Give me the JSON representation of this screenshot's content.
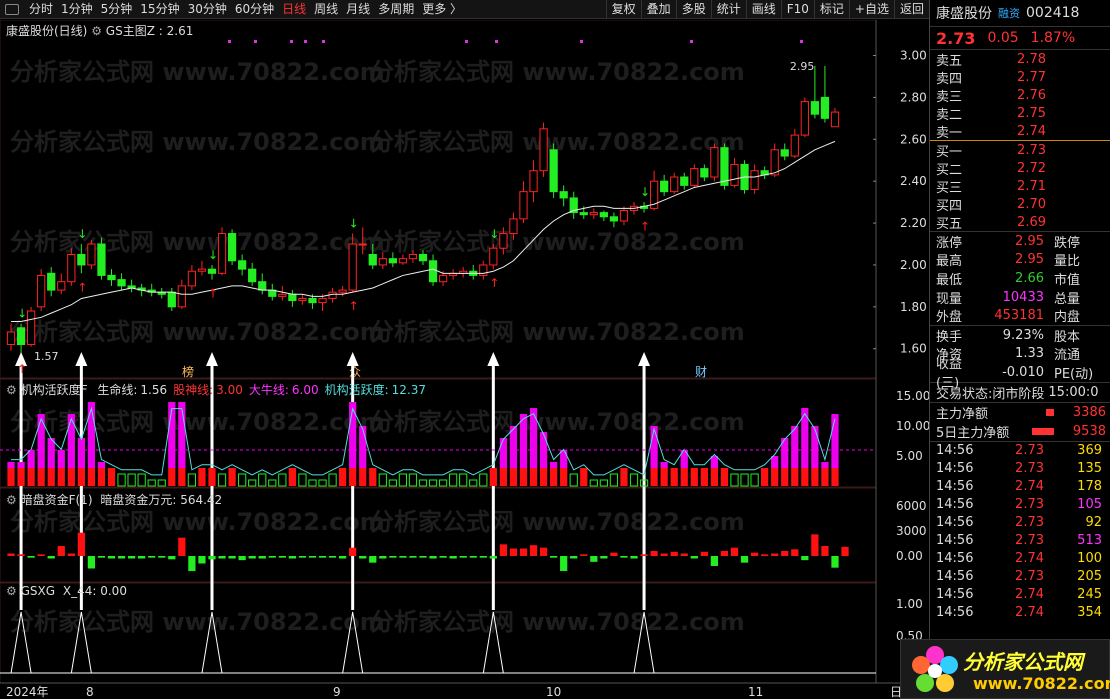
{
  "nav": {
    "periods": [
      "分时",
      "1分钟",
      "5分钟",
      "15分钟",
      "30分钟",
      "60分钟",
      "日线",
      "周线",
      "月线",
      "多周期",
      "更多 〉"
    ],
    "active": "日线",
    "tools": [
      "复权",
      "叠加",
      "多股",
      "统计",
      "画线",
      "F10",
      "标记",
      "+自选",
      "返回"
    ]
  },
  "main": {
    "stock": "康盛股份(日线)",
    "indicator": "GS主图Z",
    "indicator_value": ": 2.61",
    "max_label": "2.95",
    "min_label": "1.57",
    "axis": [
      "3.00",
      "2.80",
      "2.60",
      "2.40",
      "2.20",
      "2.00",
      "1.80",
      "1.60"
    ],
    "tags": [
      "榜",
      "众",
      "财"
    ]
  },
  "sub1": {
    "name": "机构活跃度F",
    "items": [
      {
        "label": "生命线:",
        "value": "1.56",
        "color": "#dddddd"
      },
      {
        "label": "股神线:",
        "value": "3.00",
        "color": "#ff3333"
      },
      {
        "label": "大牛线:",
        "value": "6.00",
        "color": "#ff33ff"
      },
      {
        "label": "机构活跃度:",
        "value": "12.37",
        "color": "#55dddd"
      }
    ],
    "axis": [
      "15.00",
      "10.00",
      "5.00"
    ]
  },
  "sub2": {
    "name": "暗盘资金F(1)",
    "label": "暗盘资金万元:",
    "value": "564.42",
    "axis": [
      "6000",
      "3000",
      "0.00"
    ]
  },
  "sub3": {
    "name": "GSXG",
    "label": "X_44:",
    "value": "0.00",
    "axis": [
      "1.00",
      "0.50"
    ]
  },
  "xaxis": [
    "2024年",
    "8",
    "9",
    "10",
    "11",
    "日"
  ],
  "watermark": "分析家公式网 www.70822.com",
  "quote": {
    "name": "康盛股份",
    "tag": "融资",
    "code": "002418",
    "price": "2.73",
    "change": "0.05",
    "pct": "1.87%",
    "asks": [
      [
        "卖五",
        "2.78"
      ],
      [
        "卖四",
        "2.77"
      ],
      [
        "卖三",
        "2.76"
      ],
      [
        "卖二",
        "2.75"
      ],
      [
        "卖一",
        "2.74"
      ]
    ],
    "bids": [
      [
        "买一",
        "2.73"
      ],
      [
        "买二",
        "2.72"
      ],
      [
        "买三",
        "2.71"
      ],
      [
        "买四",
        "2.70"
      ],
      [
        "买五",
        "2.69"
      ]
    ],
    "stats": [
      [
        "涨停",
        "2.95",
        "#ff3333",
        "跌停"
      ],
      [
        "最高",
        "2.95",
        "#ff3333",
        "量比"
      ],
      [
        "最低",
        "2.66",
        "#33cc33",
        "市值"
      ],
      [
        "现量",
        "10433",
        "#ff33ff",
        "总量"
      ],
      [
        "外盘",
        "453181",
        "#ff3333",
        "内盘"
      ]
    ],
    "stats2": [
      [
        "换手",
        "9.23%",
        "#dddddd",
        "股本"
      ],
      [
        "净资",
        "1.33",
        "#dddddd",
        "流通"
      ],
      [
        "收益(三)",
        "-0.010",
        "#dddddd",
        "PE(动)"
      ]
    ],
    "status_label": "交易状态:",
    "status_value": "闭市阶段",
    "status_time": "15:00:0",
    "flow": [
      [
        "主力净额",
        "3386"
      ],
      [
        "5日主力净额",
        "9538"
      ]
    ],
    "ticks": [
      [
        "14:56",
        "2.73",
        "369",
        "#ff3333",
        "#ffdd00"
      ],
      [
        "14:56",
        "2.73",
        "135",
        "#ff3333",
        "#ffdd00"
      ],
      [
        "14:56",
        "2.74",
        "178",
        "#ff3333",
        "#ffdd00"
      ],
      [
        "14:56",
        "2.73",
        "105",
        "#ff3333",
        "#ff33ff"
      ],
      [
        "14:56",
        "2.73",
        "92",
        "#ff3333",
        "#ffdd00"
      ],
      [
        "14:56",
        "2.73",
        "513",
        "#ff3333",
        "#ff33ff"
      ],
      [
        "14:56",
        "2.74",
        "100",
        "#ff3333",
        "#ffdd00"
      ],
      [
        "14:56",
        "2.73",
        "205",
        "#ff3333",
        "#ffdd00"
      ],
      [
        "14:56",
        "2.74",
        "245",
        "#ff3333",
        "#ffdd00"
      ],
      [
        "14:56",
        "2.74",
        "354",
        "#ff3333",
        "#ffdd00"
      ]
    ]
  },
  "logo": {
    "title": "分析家公式网",
    "url": "www.70822.com"
  },
  "chart_data": {
    "type": "candlestick",
    "series": [
      {
        "name": "K线",
        "values": [
          [
            1.62,
            1.68,
            1.72,
            1.59
          ],
          [
            1.7,
            1.62,
            1.72,
            1.57
          ],
          [
            1.62,
            1.78,
            1.8,
            1.61
          ],
          [
            1.8,
            1.95,
            1.98,
            1.78
          ],
          [
            1.96,
            1.88,
            1.99,
            1.85
          ],
          [
            1.88,
            1.92,
            1.96,
            1.86
          ],
          [
            1.92,
            2.05,
            2.08,
            1.9
          ],
          [
            2.05,
            2.0,
            2.1,
            1.96
          ],
          [
            2.0,
            2.1,
            2.12,
            1.98
          ],
          [
            2.1,
            1.95,
            2.13,
            1.93
          ],
          [
            1.95,
            1.93,
            1.98,
            1.9
          ],
          [
            1.93,
            1.9,
            1.96,
            1.88
          ],
          [
            1.9,
            1.89,
            1.93,
            1.87
          ],
          [
            1.89,
            1.88,
            1.91,
            1.85
          ],
          [
            1.88,
            1.87,
            1.91,
            1.85
          ],
          [
            1.87,
            1.86,
            1.89,
            1.84
          ],
          [
            1.87,
            1.8,
            1.89,
            1.78
          ],
          [
            1.8,
            1.9,
            1.93,
            1.79
          ],
          [
            1.9,
            1.97,
            2.0,
            1.88
          ],
          [
            1.97,
            1.98,
            2.02,
            1.95
          ],
          [
            1.98,
            1.96,
            2.0,
            1.93
          ],
          [
            1.96,
            2.15,
            2.18,
            1.95
          ],
          [
            2.15,
            2.02,
            2.17,
            2.0
          ],
          [
            2.02,
            1.98,
            2.05,
            1.95
          ],
          [
            1.98,
            1.92,
            2.01,
            1.9
          ],
          [
            1.92,
            1.88,
            1.96,
            1.86
          ],
          [
            1.88,
            1.85,
            1.91,
            1.83
          ],
          [
            1.85,
            1.86,
            1.9,
            1.83
          ],
          [
            1.86,
            1.83,
            1.88,
            1.8
          ],
          [
            1.83,
            1.84,
            1.86,
            1.81
          ],
          [
            1.84,
            1.82,
            1.86,
            1.79
          ],
          [
            1.82,
            1.84,
            1.86,
            1.78
          ],
          [
            1.84,
            1.87,
            1.89,
            1.82
          ],
          [
            1.87,
            1.88,
            1.9,
            1.85
          ],
          [
            1.88,
            2.1,
            2.15,
            1.87
          ],
          [
            2.1,
            2.1,
            2.18,
            2.05
          ],
          [
            2.05,
            2.0,
            2.1,
            1.98
          ],
          [
            2.0,
            2.03,
            2.06,
            1.98
          ],
          [
            2.03,
            2.01,
            2.06,
            1.99
          ],
          [
            2.01,
            2.03,
            2.05,
            2.0
          ],
          [
            2.03,
            2.05,
            2.07,
            2.01
          ],
          [
            2.05,
            2.02,
            2.07,
            2.0
          ],
          [
            2.02,
            1.92,
            2.05,
            1.9
          ],
          [
            1.92,
            1.95,
            1.97,
            1.9
          ],
          [
            1.95,
            1.96,
            1.98,
            1.93
          ],
          [
            1.96,
            1.97,
            1.99,
            1.94
          ],
          [
            1.97,
            1.95,
            2.0,
            1.93
          ],
          [
            1.95,
            2.0,
            2.02,
            1.93
          ],
          [
            2.0,
            2.08,
            2.1,
            1.98
          ],
          [
            2.08,
            2.15,
            2.18,
            2.05
          ],
          [
            2.15,
            2.22,
            2.25,
            2.12
          ],
          [
            2.22,
            2.35,
            2.4,
            2.2
          ],
          [
            2.35,
            2.45,
            2.5,
            2.3
          ],
          [
            2.45,
            2.65,
            2.68,
            2.42
          ],
          [
            2.55,
            2.35,
            2.58,
            2.32
          ],
          [
            2.35,
            2.32,
            2.38,
            2.28
          ],
          [
            2.32,
            2.25,
            2.35,
            2.22
          ],
          [
            2.25,
            2.24,
            2.28,
            2.22
          ],
          [
            2.24,
            2.25,
            2.27,
            2.22
          ],
          [
            2.25,
            2.23,
            2.26,
            2.21
          ],
          [
            2.23,
            2.21,
            2.25,
            2.18
          ],
          [
            2.21,
            2.26,
            2.28,
            2.19
          ],
          [
            2.26,
            2.28,
            2.3,
            2.24
          ],
          [
            2.28,
            2.27,
            2.3,
            2.25
          ],
          [
            2.27,
            2.4,
            2.45,
            2.26
          ],
          [
            2.4,
            2.35,
            2.43,
            2.33
          ],
          [
            2.35,
            2.42,
            2.44,
            2.34
          ],
          [
            2.42,
            2.38,
            2.44,
            2.36
          ],
          [
            2.38,
            2.46,
            2.48,
            2.37
          ],
          [
            2.46,
            2.42,
            2.48,
            2.4
          ],
          [
            2.42,
            2.56,
            2.58,
            2.4
          ],
          [
            2.56,
            2.38,
            2.58,
            2.36
          ],
          [
            2.38,
            2.48,
            2.51,
            2.37
          ],
          [
            2.48,
            2.36,
            2.5,
            2.34
          ],
          [
            2.36,
            2.45,
            2.48,
            2.34
          ],
          [
            2.45,
            2.43,
            2.47,
            2.41
          ],
          [
            2.43,
            2.55,
            2.58,
            2.42
          ],
          [
            2.55,
            2.52,
            2.58,
            2.5
          ],
          [
            2.52,
            2.62,
            2.65,
            2.51
          ],
          [
            2.62,
            2.78,
            2.8,
            2.61
          ],
          [
            2.78,
            2.72,
            2.95,
            2.7
          ],
          [
            2.8,
            2.7,
            2.95,
            2.68
          ],
          [
            2.66,
            2.73,
            2.75,
            2.66
          ]
        ]
      },
      {
        "name": "生命线",
        "values": [
          1.73,
          1.73,
          1.74,
          1.75,
          1.77,
          1.79,
          1.81,
          1.84,
          1.85,
          1.86,
          1.87,
          1.88,
          1.89,
          1.88,
          1.87,
          1.87,
          1.87,
          1.86,
          1.86,
          1.87,
          1.88,
          1.89,
          1.9,
          1.9,
          1.89,
          1.88,
          1.88,
          1.87,
          1.86,
          1.86,
          1.85,
          1.85,
          1.86,
          1.86,
          1.87,
          1.88,
          1.89,
          1.91,
          1.93,
          1.95,
          1.96,
          1.97,
          1.98,
          1.96,
          1.96,
          1.96,
          1.96,
          1.96,
          1.97,
          1.99,
          2.02,
          2.07,
          2.12,
          2.17,
          2.21,
          2.24,
          2.26,
          2.27,
          2.28,
          2.28,
          2.27,
          2.27,
          2.27,
          2.28,
          2.29,
          2.31,
          2.33,
          2.35,
          2.37,
          2.38,
          2.39,
          2.4,
          2.41,
          2.42,
          2.42,
          2.43,
          2.44,
          2.46,
          2.49,
          2.52,
          2.55,
          2.57,
          2.59
        ]
      }
    ],
    "ylim": [
      1.5,
      3.05
    ]
  }
}
